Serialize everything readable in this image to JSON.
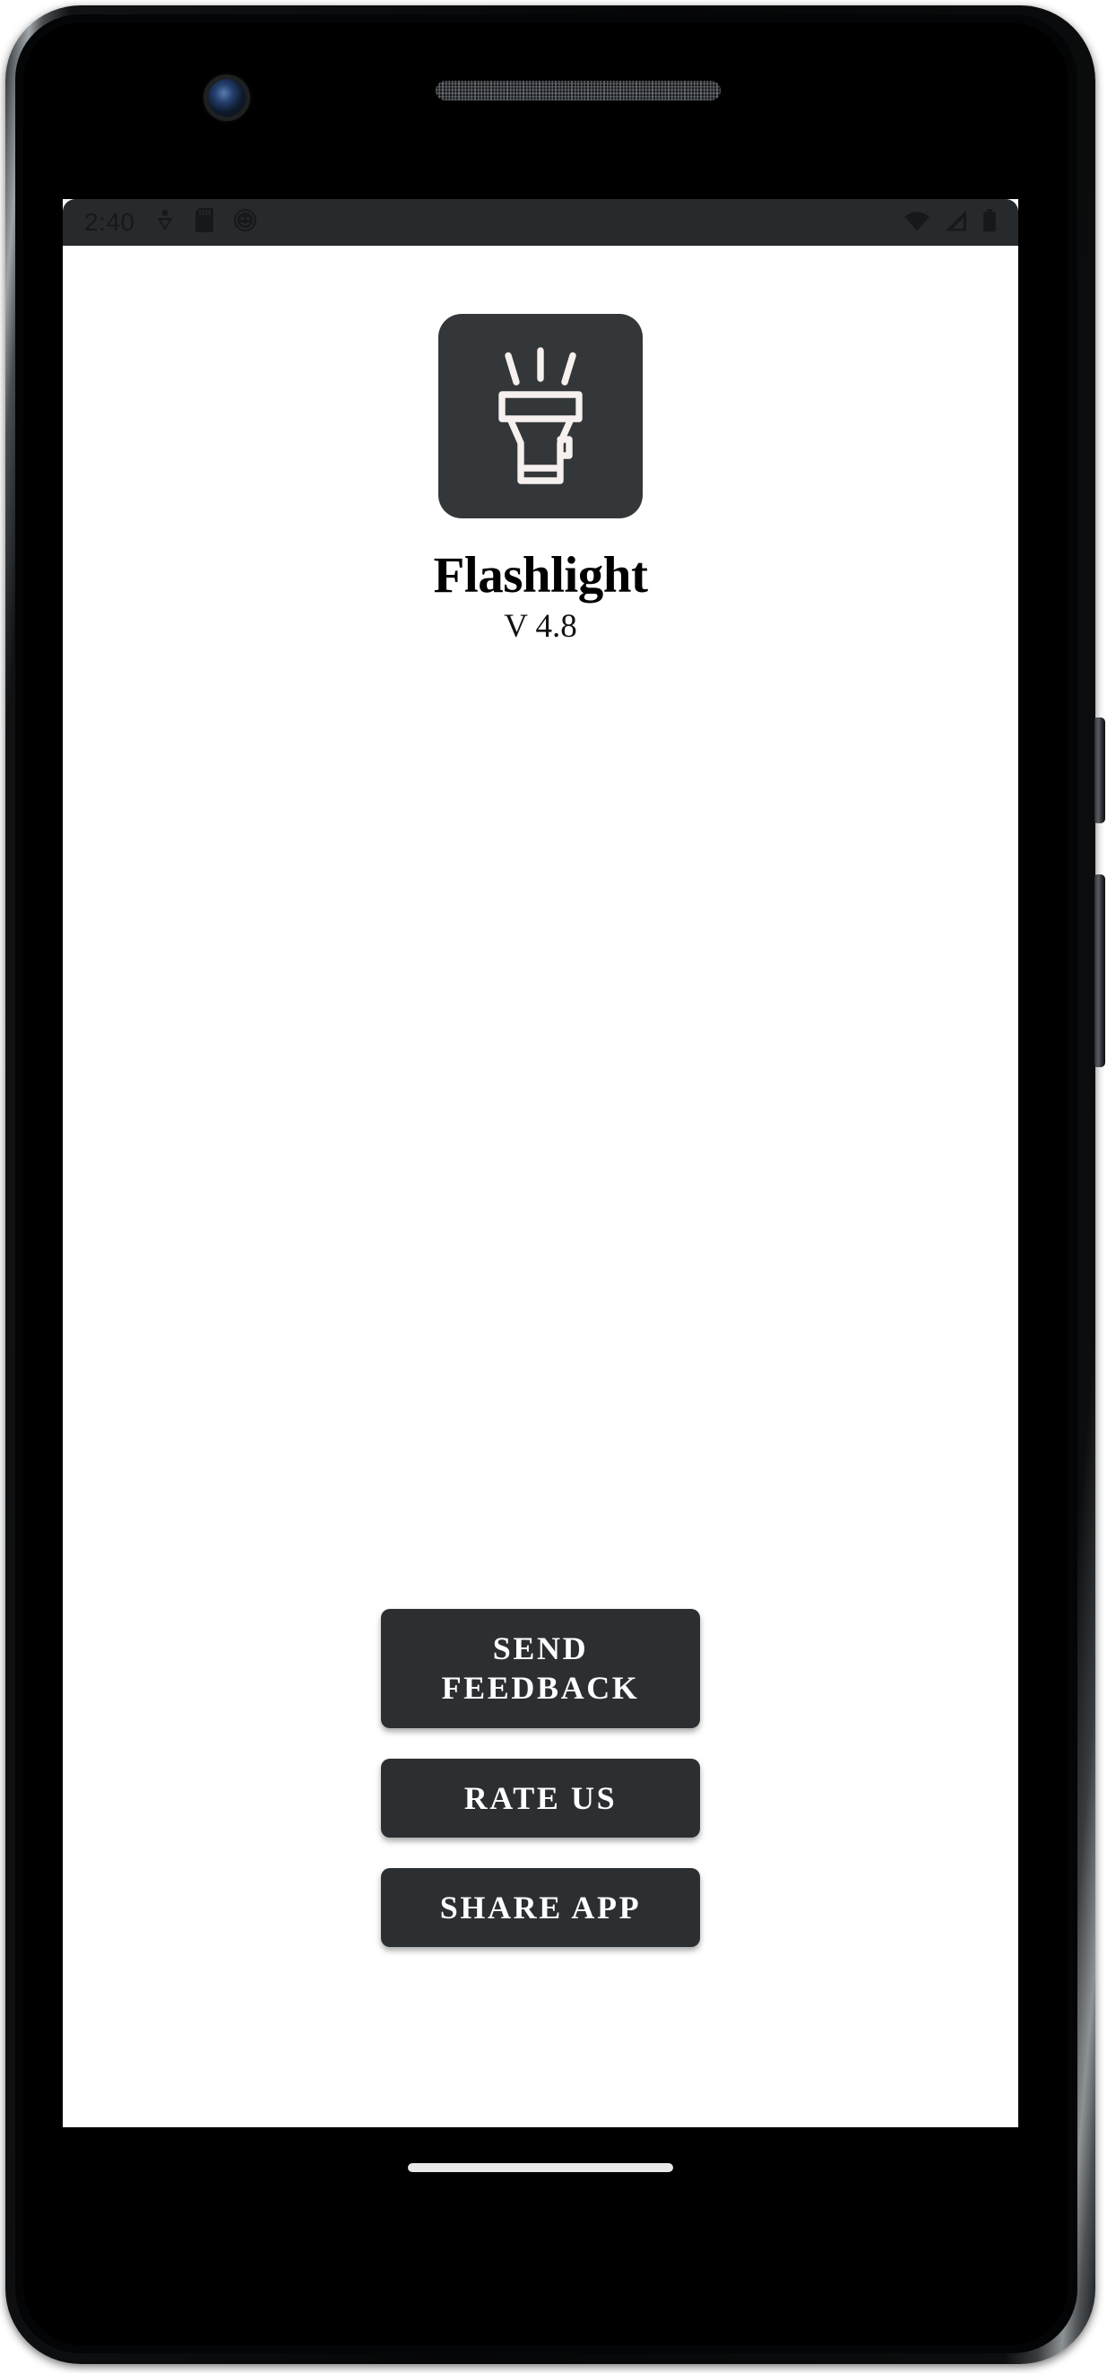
{
  "device": {
    "name": "android-phone-mockup",
    "hardware": {
      "front_camera": "front-camera",
      "earpiece": "earpiece-speaker",
      "power_button": "power-button",
      "volume_button": "volume-rocker-button"
    }
  },
  "status_bar": {
    "time": "2:40",
    "background_color": "#262a2c",
    "icon_color": "#16191b",
    "notification_icons": [
      {
        "name": "downloads-icon",
        "glyph": "download"
      },
      {
        "name": "sd-card-icon",
        "glyph": "sd-card"
      },
      {
        "name": "face-avatar-icon",
        "glyph": "face"
      }
    ],
    "system_icons": [
      {
        "name": "wifi-icon",
        "glyph": "wifi"
      },
      {
        "name": "cellular-signal-icon",
        "glyph": "signal-triangle"
      },
      {
        "name": "battery-icon",
        "glyph": "battery-full"
      }
    ]
  },
  "app": {
    "icon_name": "flashlight-app-icon",
    "icon_tile_color": "#333739",
    "icon_stroke_color": "#f6f0ee",
    "title": "Flashlight",
    "version": "V 4.8",
    "background_color": "#ffffff",
    "text_color": "#000000"
  },
  "buttons": {
    "accent_color": "#2b2f31",
    "label_color": "#ffffff",
    "send_feedback": "SEND\nFEEDBACK",
    "rate_us": "RATE US",
    "share_app": "SHARE APP"
  },
  "navigation": {
    "home_indicator_color": "#e8e8e8",
    "background_color": "#000000"
  }
}
